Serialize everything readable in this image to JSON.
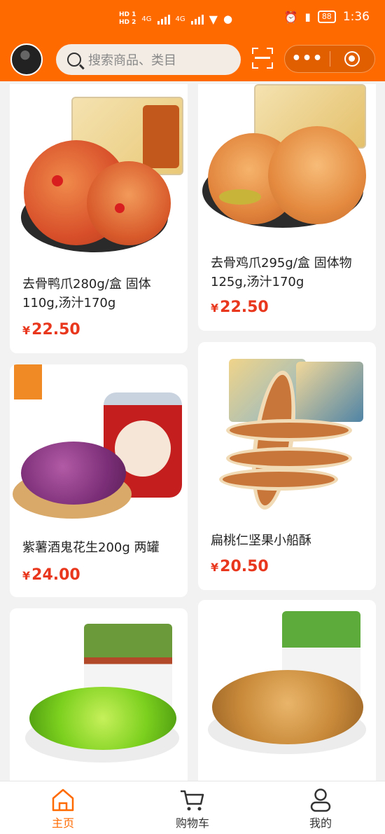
{
  "status_bar": {
    "hd1": "HD 1",
    "hd2": "HD 2",
    "net1": "4G",
    "net2": "4G",
    "battery": "88",
    "time": "1:36"
  },
  "header": {
    "search_placeholder": "搜索商品、类目",
    "menu_dots": "•••"
  },
  "products": [
    {
      "title": "去骨鸭爪280g/盒 固体110g,汤汁170g",
      "price": "22.50",
      "currency": "¥"
    },
    {
      "title": "去骨鸡爪295g/盒 固体物125g,汤汁170g",
      "price": "22.50",
      "currency": "¥"
    },
    {
      "title": "紫薯酒鬼花生200g 两罐",
      "price": "24.00",
      "currency": "¥"
    },
    {
      "title": "扁桃仁坚果小船酥",
      "price": "20.50",
      "currency": "¥"
    }
  ],
  "tabbar": {
    "home": "主页",
    "cart": "购物车",
    "mine": "我的"
  },
  "colors": {
    "brand": "#ff6a00",
    "price": "#e8371d"
  }
}
